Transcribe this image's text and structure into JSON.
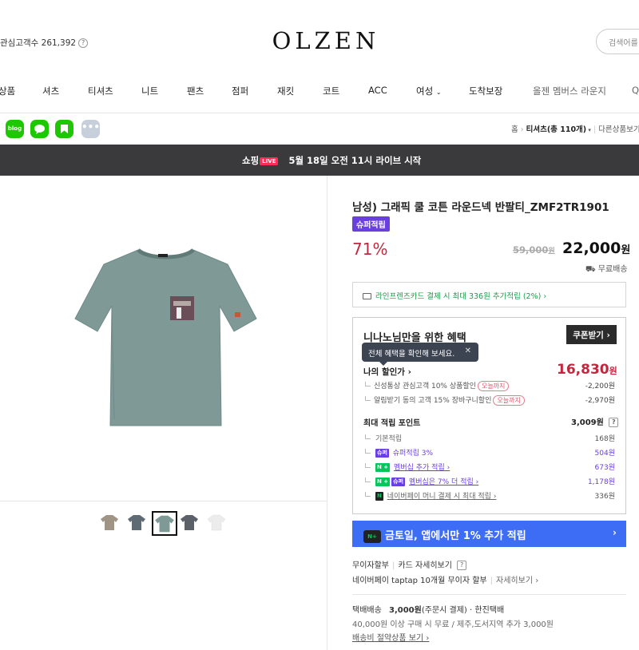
{
  "header": {
    "customer_count": "관심고객수 261,392",
    "help_q": "?",
    "logo": "OLZEN",
    "search_placeholder": "검색어를"
  },
  "gnb": {
    "items": [
      {
        "label": "상품"
      },
      {
        "label": "셔츠"
      },
      {
        "label": "티셔츠"
      },
      {
        "label": "니트"
      },
      {
        "label": "팬츠"
      },
      {
        "label": "점퍼"
      },
      {
        "label": "재킷"
      },
      {
        "label": "코트"
      },
      {
        "label": "ACC"
      },
      {
        "label": "여성"
      },
      {
        "label": "도착보장"
      },
      {
        "label": "올젠 멤버스 라운지"
      },
      {
        "label": "Q"
      }
    ]
  },
  "share": {
    "icons": [
      "blog-icon",
      "line-icon",
      "talk-icon",
      "more-icon"
    ],
    "blog_label": "blog"
  },
  "breadcrumb": {
    "home": "홈",
    "current": "티셔츠(총 110개)",
    "other": "다른상품보기"
  },
  "live": {
    "prefix": "쇼핑",
    "badge": "LIVE",
    "text": "5월 18일 오전 11시 라이브 시작"
  },
  "product": {
    "title": "남성) 그래픽 쿨 코튼 라운드넥 반팔티_ZMF2TR1901",
    "badge": "슈퍼적립",
    "discount": "71%",
    "orig_price": "59,000",
    "price": "22,000",
    "won": "원",
    "shipping": "무료배송",
    "card_benefit": "라인프렌즈카드 결제 시 최대 336원 추가적립 (2%) ›"
  },
  "benefit": {
    "title": "니나노님만을 위한 혜택",
    "coupon_btn": "쿠폰받기 ›",
    "tooltip": "전체 혜택을 확인해 보세요.",
    "tooltip_close": "✕",
    "my_price_label": "나의 할인가 ›",
    "my_price": "16,830",
    "discounts": [
      {
        "label": "신성통상 관심고객 10% 상품할인",
        "tag": "오늘까지",
        "amount": "-2,200원"
      },
      {
        "label": "알림받기 동의 고객 15% 장바구니할인",
        "tag": "오늘까지",
        "amount": "-2,970원"
      }
    ],
    "points_title": "최대 적립 포인트",
    "points_total": "3,009원",
    "points_q": "?",
    "points": [
      {
        "label": "기본적립",
        "amount": "168원"
      },
      {
        "label": "슈퍼적립 3%",
        "amount": "504원"
      },
      {
        "label": "멤버십 추가 적립 ›",
        "amount": "673원"
      },
      {
        "label": "멤버십은 7% 더 적립 ›",
        "amount": "1,178원"
      },
      {
        "label": "네이버페이 머니 결제 시 최대 적립 ›",
        "amount": "336원"
      }
    ],
    "mini_super": "슈퍼",
    "mini_n": "N",
    "mini_plus": "+"
  },
  "app_banner": {
    "np": "N+",
    "text": "금토일, 앱에서만 1% 추가 적립",
    "arrow": "›"
  },
  "payment": {
    "installment": "무이자할부",
    "card_detail": "카드 자세히보기",
    "q": "?",
    "taptap": "네이버페이 taptap 10개월 무이자 할부",
    "detail": "자세히보기 ›"
  },
  "delivery": {
    "label": "택배배송",
    "fee": "3,000원",
    "fee_note": "(주문시 결제)",
    "courier": "· 한진택배",
    "free_note": "40,000원 이상 구매 시 무료 / 제주,도서지역 추가 3,000원",
    "save_link": "배송비 절약상품 보기 ›"
  },
  "thumbnails": [
    {
      "color": "#a09484",
      "selected": false
    },
    {
      "color": "#5f6b74",
      "selected": false
    },
    {
      "color": "#7e9996",
      "selected": true
    },
    {
      "color": "#5c6068",
      "selected": false
    },
    {
      "color": "#ececec",
      "selected": false
    }
  ],
  "colors": {
    "accent_red": "#c0283f",
    "super_purple": "#6a3fe0",
    "naver_green": "#03c75a",
    "banner_blue": "#3d6cf5",
    "shirt": "#7e9996"
  }
}
